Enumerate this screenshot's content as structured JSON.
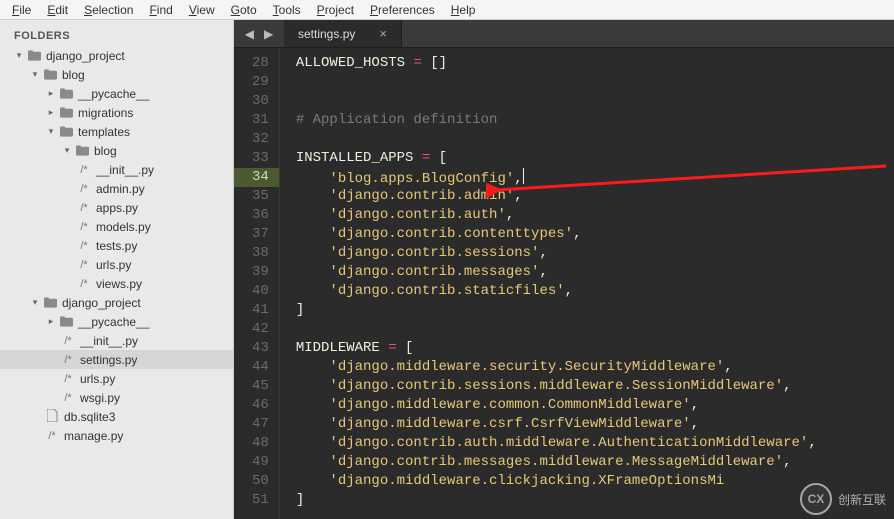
{
  "menubar": [
    "File",
    "Edit",
    "Selection",
    "Find",
    "View",
    "Goto",
    "Tools",
    "Project",
    "Preferences",
    "Help"
  ],
  "sidebar": {
    "title": "FOLDERS",
    "tree": [
      {
        "depth": 0,
        "type": "folder",
        "open": true,
        "name": "django_project"
      },
      {
        "depth": 1,
        "type": "folder",
        "open": true,
        "name": "blog"
      },
      {
        "depth": 2,
        "type": "folder",
        "open": false,
        "name": "__pycache__"
      },
      {
        "depth": 2,
        "type": "folder",
        "open": false,
        "name": "migrations"
      },
      {
        "depth": 2,
        "type": "folder",
        "open": true,
        "name": "templates"
      },
      {
        "depth": 3,
        "type": "folder",
        "open": true,
        "name": "blog"
      },
      {
        "depth": 3,
        "type": "file",
        "ext": "/*",
        "name": "__init__.py"
      },
      {
        "depth": 3,
        "type": "file",
        "ext": "/*",
        "name": "admin.py"
      },
      {
        "depth": 3,
        "type": "file",
        "ext": "/*",
        "name": "apps.py"
      },
      {
        "depth": 3,
        "type": "file",
        "ext": "/*",
        "name": "models.py"
      },
      {
        "depth": 3,
        "type": "file",
        "ext": "/*",
        "name": "tests.py"
      },
      {
        "depth": 3,
        "type": "file",
        "ext": "/*",
        "name": "urls.py"
      },
      {
        "depth": 3,
        "type": "file",
        "ext": "/*",
        "name": "views.py"
      },
      {
        "depth": 1,
        "type": "folder",
        "open": true,
        "name": "django_project"
      },
      {
        "depth": 2,
        "type": "folder",
        "open": false,
        "name": "__pycache__"
      },
      {
        "depth": 2,
        "type": "file",
        "ext": "/*",
        "name": "__init__.py"
      },
      {
        "depth": 2,
        "type": "file",
        "ext": "/*",
        "name": "settings.py",
        "selected": true
      },
      {
        "depth": 2,
        "type": "file",
        "ext": "/*",
        "name": "urls.py"
      },
      {
        "depth": 2,
        "type": "file",
        "ext": "/*",
        "name": "wsgi.py"
      },
      {
        "depth": 1,
        "type": "file",
        "ext": "doc",
        "name": "db.sqlite3"
      },
      {
        "depth": 1,
        "type": "file",
        "ext": "/*",
        "name": "manage.py"
      }
    ]
  },
  "tabs": {
    "active": "settings.py",
    "close": "×"
  },
  "code": {
    "first_line": 28,
    "highlight_line": 34,
    "lines": [
      {
        "n": 28,
        "seg": [
          [
            "kw",
            "ALLOWED_HOSTS"
          ],
          [
            "plain",
            " "
          ],
          [
            "op",
            "="
          ],
          [
            "plain",
            " "
          ],
          [
            "punc",
            "[]"
          ]
        ]
      },
      {
        "n": 29,
        "seg": []
      },
      {
        "n": 30,
        "seg": []
      },
      {
        "n": 31,
        "seg": [
          [
            "cmt",
            "# Application definition"
          ]
        ]
      },
      {
        "n": 32,
        "seg": []
      },
      {
        "n": 33,
        "seg": [
          [
            "kw",
            "INSTALLED_APPS"
          ],
          [
            "plain",
            " "
          ],
          [
            "op",
            "="
          ],
          [
            "plain",
            " "
          ],
          [
            "punc",
            "["
          ]
        ]
      },
      {
        "n": 34,
        "seg": [
          [
            "plain",
            "    "
          ],
          [
            "str",
            "'blog.apps.BlogConfig'"
          ],
          [
            "punc",
            ","
          ],
          [
            "caret",
            ""
          ]
        ]
      },
      {
        "n": 35,
        "seg": [
          [
            "plain",
            "    "
          ],
          [
            "str",
            "'django.contrib.admin'"
          ],
          [
            "punc",
            ","
          ]
        ]
      },
      {
        "n": 36,
        "seg": [
          [
            "plain",
            "    "
          ],
          [
            "str",
            "'django.contrib.auth'"
          ],
          [
            "punc",
            ","
          ]
        ]
      },
      {
        "n": 37,
        "seg": [
          [
            "plain",
            "    "
          ],
          [
            "str",
            "'django.contrib.contenttypes'"
          ],
          [
            "punc",
            ","
          ]
        ]
      },
      {
        "n": 38,
        "seg": [
          [
            "plain",
            "    "
          ],
          [
            "str",
            "'django.contrib.sessions'"
          ],
          [
            "punc",
            ","
          ]
        ]
      },
      {
        "n": 39,
        "seg": [
          [
            "plain",
            "    "
          ],
          [
            "str",
            "'django.contrib.messages'"
          ],
          [
            "punc",
            ","
          ]
        ]
      },
      {
        "n": 40,
        "seg": [
          [
            "plain",
            "    "
          ],
          [
            "str",
            "'django.contrib.staticfiles'"
          ],
          [
            "punc",
            ","
          ]
        ]
      },
      {
        "n": 41,
        "seg": [
          [
            "punc",
            "]"
          ]
        ]
      },
      {
        "n": 42,
        "seg": []
      },
      {
        "n": 43,
        "seg": [
          [
            "kw",
            "MIDDLEWARE"
          ],
          [
            "plain",
            " "
          ],
          [
            "op",
            "="
          ],
          [
            "plain",
            " "
          ],
          [
            "punc",
            "["
          ]
        ]
      },
      {
        "n": 44,
        "seg": [
          [
            "plain",
            "    "
          ],
          [
            "str",
            "'django.middleware.security.SecurityMiddleware'"
          ],
          [
            "punc",
            ","
          ]
        ]
      },
      {
        "n": 45,
        "seg": [
          [
            "plain",
            "    "
          ],
          [
            "str",
            "'django.contrib.sessions.middleware.SessionMiddleware'"
          ],
          [
            "punc",
            ","
          ]
        ]
      },
      {
        "n": 46,
        "seg": [
          [
            "plain",
            "    "
          ],
          [
            "str",
            "'django.middleware.common.CommonMiddleware'"
          ],
          [
            "punc",
            ","
          ]
        ]
      },
      {
        "n": 47,
        "seg": [
          [
            "plain",
            "    "
          ],
          [
            "str",
            "'django.middleware.csrf.CsrfViewMiddleware'"
          ],
          [
            "punc",
            ","
          ]
        ]
      },
      {
        "n": 48,
        "seg": [
          [
            "plain",
            "    "
          ],
          [
            "str",
            "'django.contrib.auth.middleware.AuthenticationMiddleware'"
          ],
          [
            "punc",
            ","
          ]
        ]
      },
      {
        "n": 49,
        "seg": [
          [
            "plain",
            "    "
          ],
          [
            "str",
            "'django.contrib.messages.middleware.MessageMiddleware'"
          ],
          [
            "punc",
            ","
          ]
        ]
      },
      {
        "n": 50,
        "seg": [
          [
            "plain",
            "    "
          ],
          [
            "str",
            "'django.middleware.clickjacking.XFrameOptionsMi"
          ]
        ]
      },
      {
        "n": 51,
        "seg": [
          [
            "punc",
            "]"
          ]
        ]
      }
    ]
  },
  "watermark": {
    "logo": "CX",
    "text": "创新互联"
  }
}
